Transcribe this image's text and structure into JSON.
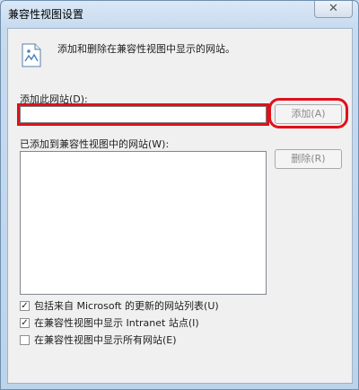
{
  "window": {
    "title": "兼容性视图设置",
    "close_glyph": "✕"
  },
  "header": {
    "description": "添加和删除在兼容性视图中显示的网站。",
    "icon": "web-page-icon"
  },
  "add_section": {
    "label": "添加此网站(D):",
    "input_value": "",
    "add_button": "添加(A)"
  },
  "list_section": {
    "label": "已添加到兼容性视图中的网站(W):",
    "items": [],
    "remove_button": "删除(R)"
  },
  "options": [
    {
      "label": "包括来自 Microsoft 的更新的网站列表(U)",
      "checked": true
    },
    {
      "label": "在兼容性视图中显示 Intranet 站点(I)",
      "checked": true
    },
    {
      "label": "在兼容性视图中显示所有网站(E)",
      "checked": false
    }
  ],
  "annotation_color": "#e0101a"
}
